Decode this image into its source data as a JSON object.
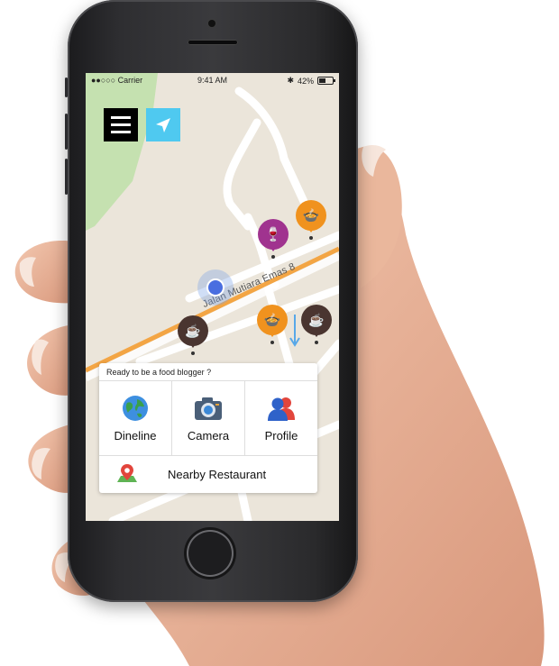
{
  "status": {
    "carrier": "●●○○○ Carrier",
    "time": "9:41 AM",
    "battery": "42%",
    "battery_level": 0.42
  },
  "map": {
    "street_name": "Jalan Mutiara Emas 8"
  },
  "card": {
    "heading": "Ready to be a food blogger ?",
    "actions": [
      {
        "label": "Dineline",
        "icon": "globe-icon"
      },
      {
        "label": "Camera",
        "icon": "camera-icon"
      },
      {
        "label": "Profile",
        "icon": "profile-icon"
      }
    ],
    "nearby_label": "Nearby Restaurant",
    "nearby_icon": "map-pin-icon"
  },
  "colors": {
    "accent_blue": "#4fc9f0",
    "pin_orange": "#f0921e",
    "pin_purple": "#a0338f",
    "pin_brown": "#4a3530"
  }
}
